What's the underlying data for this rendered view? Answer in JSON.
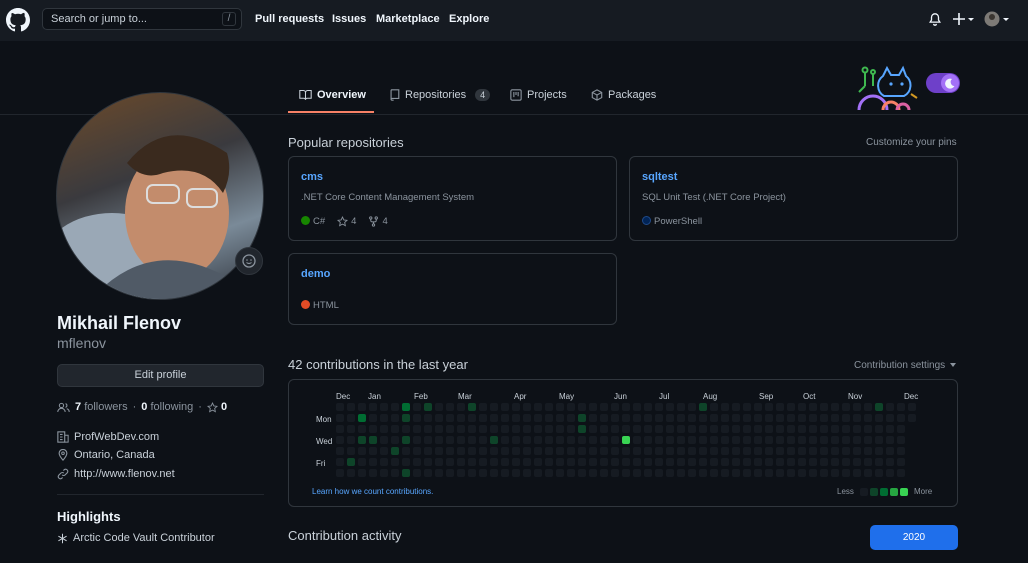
{
  "header": {
    "search_placeholder": "Search or jump to...",
    "search_key": "/",
    "nav": [
      "Pull requests",
      "Issues",
      "Marketplace",
      "Explore"
    ]
  },
  "tabs": {
    "overview": "Overview",
    "repositories": "Repositories",
    "repositories_count": "4",
    "projects": "Projects",
    "packages": "Packages"
  },
  "profile": {
    "name": "Mikhail Flenov",
    "login": "mflenov",
    "edit_label": "Edit profile",
    "followers_count": "7",
    "followers_label": "followers",
    "dot": "·",
    "following_count": "0",
    "following_label": "following",
    "stars_count": "0",
    "company": "ProfWebDev.com",
    "location": "Ontario, Canada",
    "website": "http://www.flenov.net",
    "highlights_title": "Highlights",
    "highlight_item": "Arctic Code Vault Contributor"
  },
  "popular": {
    "title": "Popular repositories",
    "customize": "Customize your pins",
    "repos": [
      {
        "name": "cms",
        "description": ".NET Core Content Management System",
        "language": "C#",
        "lang_color": "#178600",
        "stars": "4",
        "forks": "4"
      },
      {
        "name": "sqltest",
        "description": "SQL Unit Test (.NET Core Project)",
        "language": "PowerShell",
        "lang_color": "#012456"
      },
      {
        "name": "demo",
        "description": "",
        "language": "HTML",
        "lang_color": "#e34c26"
      }
    ]
  },
  "contributions": {
    "title": "42 contributions in the last year",
    "settings": "Contribution settings",
    "months": [
      "Dec",
      "Jan",
      "Feb",
      "Mar",
      "Apr",
      "May",
      "Jun",
      "Jul",
      "Aug",
      "Sep",
      "Oct",
      "Nov",
      "Dec"
    ],
    "days": [
      "Mon",
      "Wed",
      "Fri"
    ],
    "learn_link": "Learn how we count contributions.",
    "less": "Less",
    "more": "More",
    "level_colors": [
      "#161b22",
      "#0e4429",
      "#006d32",
      "#26a641",
      "#39d353"
    ]
  },
  "activity": {
    "title": "Contribution activity",
    "year": "2020"
  }
}
